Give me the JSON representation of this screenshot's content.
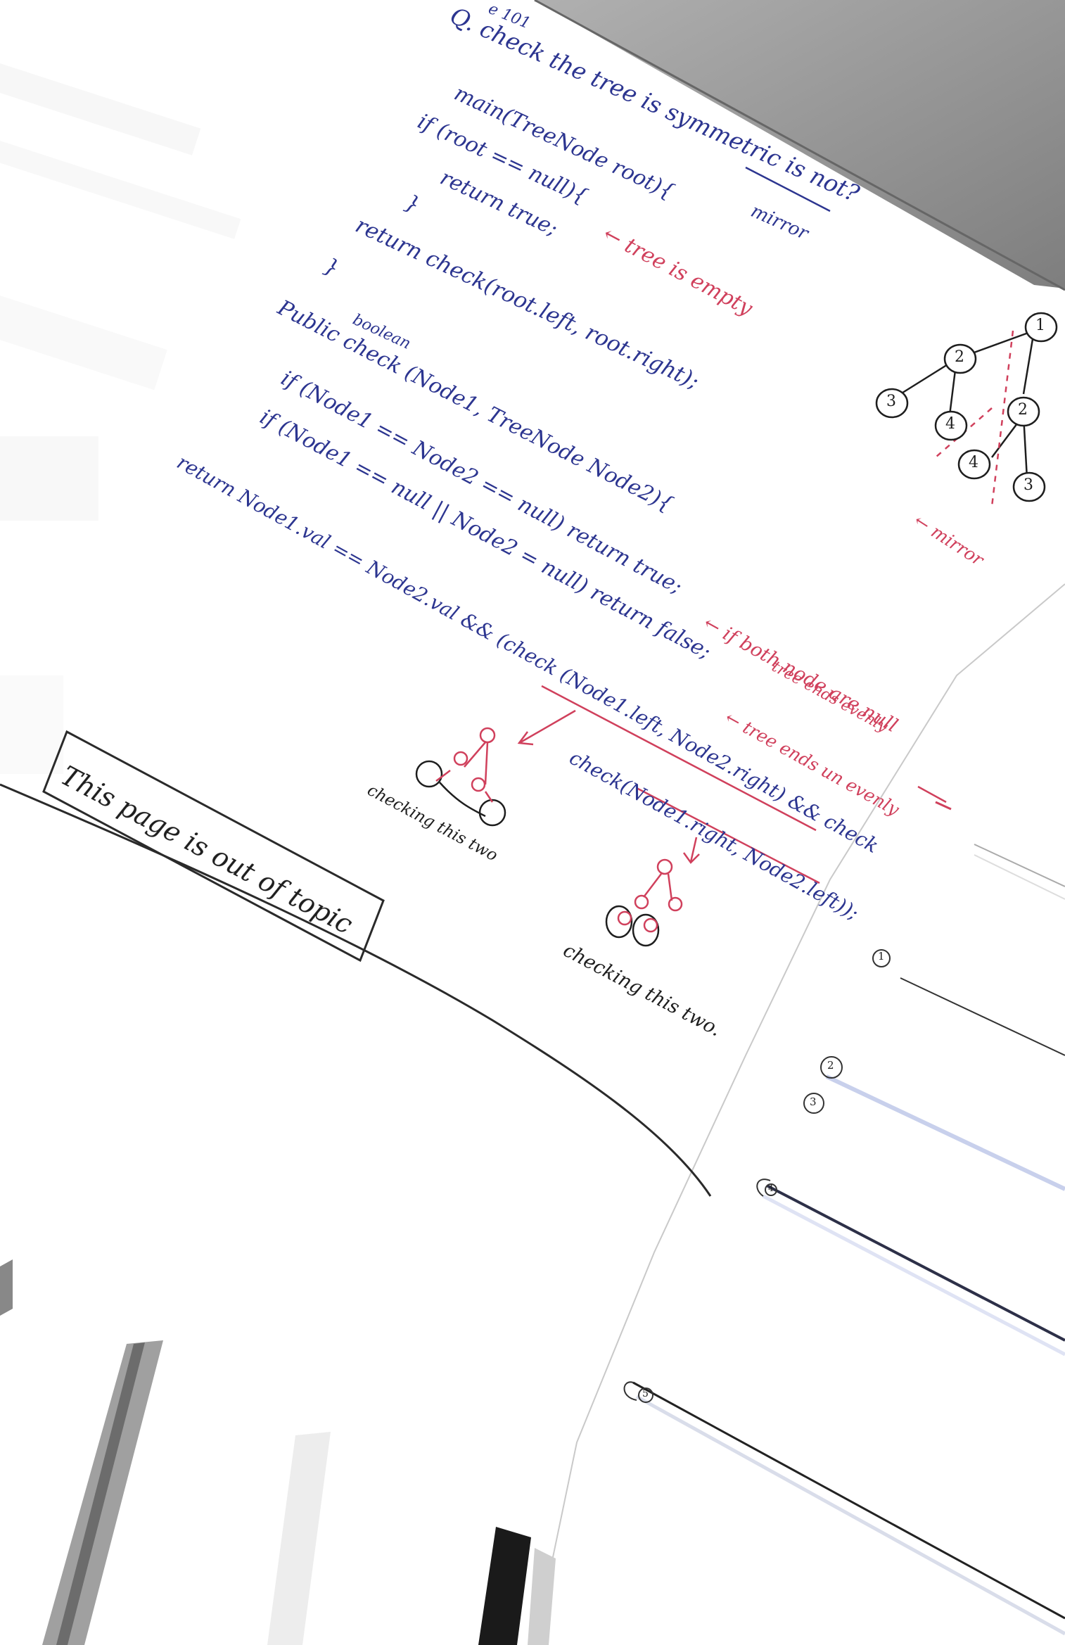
{
  "header_fragment": "e 101",
  "question": "Q. check the tree is symmetric is not?",
  "mirror_word": "mirror",
  "code": [
    "main(TreeNode root){",
    "if (root == null){",
    "return true;",
    "}",
    "return check(root.left, root.right);",
    "}",
    "boolean",
    "Public check (Node1, TreeNode Node2){",
    "if (Node1 == Node2 == null) return true;",
    "if (Node1 == null || Node2 = null) return false;",
    "return Node1.val == Node2.val && (check (Node1.left, Node2.right) && check",
    "check(Node1.right, Node2.left));"
  ],
  "annotations": {
    "empty": "← tree is empty",
    "both_null": "← if both node are null",
    "evenly": "tree ends evenly",
    "unevenly": "← tree ends un evenly",
    "mirror": "← mirror",
    "checking_1": "checking this two",
    "checking_2": "checking this two."
  },
  "tree_nodes": [
    "1",
    "2",
    "3",
    "4",
    "2",
    "4",
    "3"
  ],
  "side_markers": [
    "1",
    "2",
    "3",
    "4",
    "5"
  ],
  "boxed_note": "This page is out of topic",
  "colors": {
    "blue_ink": "#2c3590",
    "red_ink": "#d0405c",
    "black_ink": "#1e1e1e",
    "gray_shadow": "#9a9a9a"
  }
}
